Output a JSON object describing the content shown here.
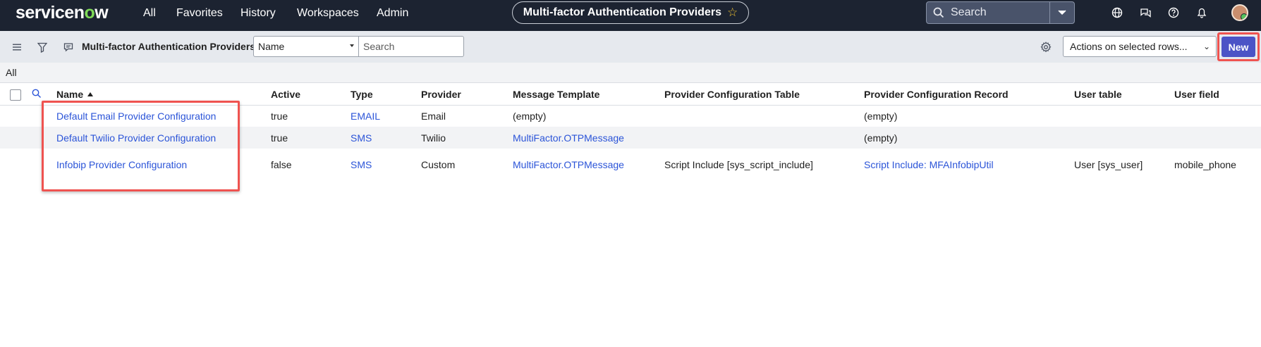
{
  "brand": {
    "logo_pre": "servicen",
    "logo_o": "o",
    "logo_post": "w"
  },
  "topnav": {
    "links": [
      "All",
      "Favorites",
      "History",
      "Workspaces",
      "Admin"
    ],
    "title": "Multi-factor Authentication Providers",
    "search_placeholder": "Search"
  },
  "listbar": {
    "title": "Multi-factor Authentication Providers",
    "field_select_value": "Name",
    "search_placeholder": "Search",
    "actions_value": "Actions on selected rows...",
    "new_label": "New"
  },
  "breadcrumb": "All",
  "table": {
    "columns": [
      "Name",
      "Active",
      "Type",
      "Provider",
      "Message Template",
      "Provider Configuration Table",
      "Provider Configuration Record",
      "User table",
      "User field"
    ],
    "rows": [
      [
        "Default Email Provider Configuration",
        "true",
        "EMAIL",
        "Email",
        "(empty)",
        "",
        "(empty)",
        "",
        ""
      ],
      [
        "Default Twilio Provider Configuration",
        "true",
        "SMS",
        "Twilio",
        "MultiFactor.OTPMessage",
        "",
        "(empty)",
        "",
        ""
      ],
      [
        "Infobip Provider Configuration",
        "false",
        "SMS",
        "Custom",
        "MultiFactor.OTPMessage",
        "Script Include [sys_script_include]",
        "Script Include: MFAInfobipUtil",
        "User [sys_user]",
        "mobile_phone"
      ]
    ]
  },
  "colors": {
    "nav_bg": "#1c2331",
    "link": "#2b54d8",
    "new_button": "#4b53c6",
    "highlight": "#ef5350",
    "brand_accent": "#7ed957"
  },
  "icons": [
    "hamburger-icon",
    "filter-icon",
    "chat-icon",
    "search-icon",
    "chevron-down-icon",
    "globe-icon",
    "comments-icon",
    "help-icon",
    "bell-icon",
    "gear-icon",
    "star-icon"
  ]
}
